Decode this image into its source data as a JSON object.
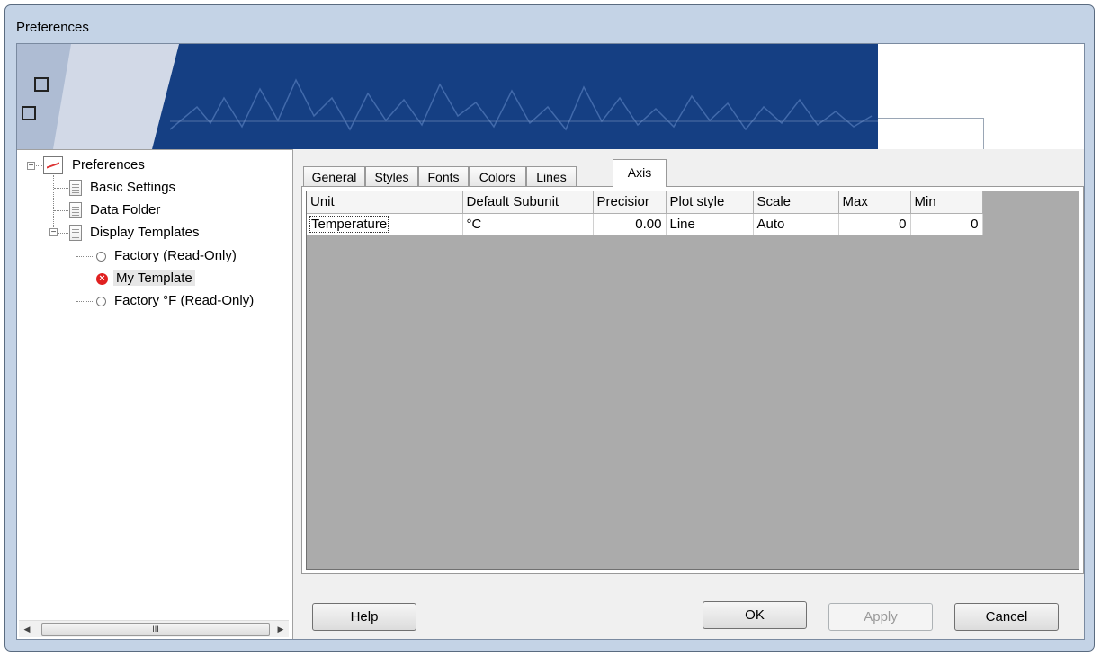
{
  "window": {
    "title": "Preferences"
  },
  "tree": {
    "items": [
      {
        "label": "Preferences"
      },
      {
        "label": "Basic Settings"
      },
      {
        "label": "Data Folder"
      },
      {
        "label": "Display Templates"
      },
      {
        "label": "Factory (Read-Only)"
      },
      {
        "label": "My Template"
      },
      {
        "label": "Factory °F (Read-Only)"
      }
    ],
    "scrollbar_thumb": "III"
  },
  "tabs": [
    {
      "label": "General"
    },
    {
      "label": "Styles"
    },
    {
      "label": "Fonts"
    },
    {
      "label": "Colors"
    },
    {
      "label": "Lines"
    },
    {
      "label": "Axis"
    }
  ],
  "active_tab": "Axis",
  "axis_table": {
    "columns": [
      "Unit",
      "Default Subunit",
      "Precisior",
      "Plot style",
      "Scale",
      "Max",
      "Min"
    ],
    "rows": [
      {
        "unit": "Temperature",
        "subunit": "°C",
        "precision": "0.00",
        "plot_style": "Line",
        "scale": "Auto",
        "max": "0",
        "min": "0"
      }
    ]
  },
  "buttons": {
    "help": "Help",
    "ok": "OK",
    "apply": "Apply",
    "cancel": "Cancel"
  },
  "colors": {
    "banner": "#153f83",
    "window_frame": "#c4d3e6",
    "grid_background": "#ababab"
  }
}
